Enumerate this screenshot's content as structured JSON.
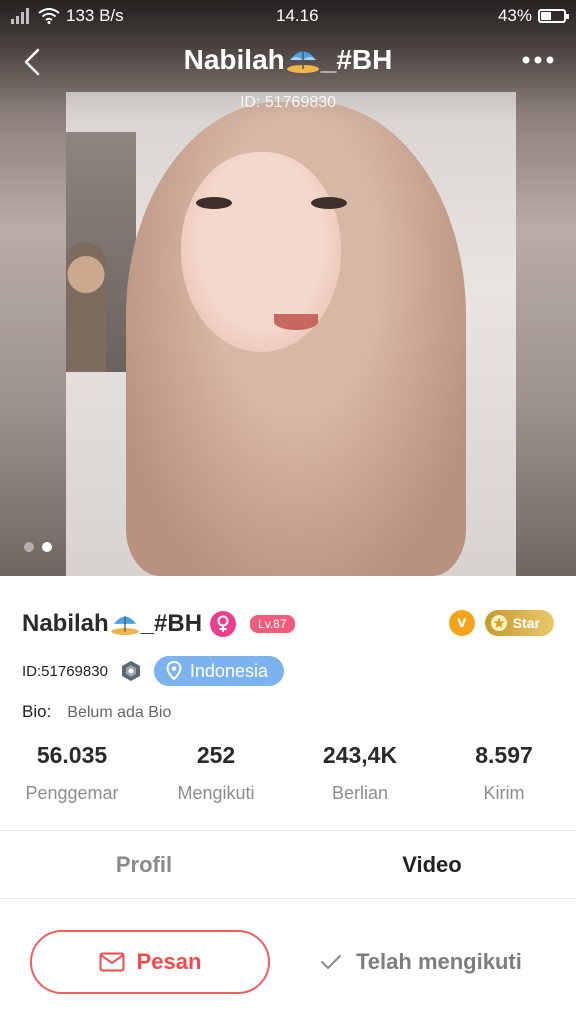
{
  "status_bar": {
    "speed": "133 B/s",
    "time": "14.16",
    "battery": "43%",
    "battery_level": 0.43
  },
  "header": {
    "title_prefix": "Nabilah",
    "title_suffix": "_#BH",
    "id_line": "ID: 51769830"
  },
  "carousel": {
    "page_count": 2,
    "active_index": 1
  },
  "profile": {
    "name_prefix": "Nabilah",
    "name_suffix": "_#BH",
    "level": "Lv.87",
    "v_badge": "v",
    "star_label": "Star",
    "id_text": "ID:51769830",
    "location": "Indonesia",
    "bio_label": "Bio:",
    "bio_text": "Belum ada Bio"
  },
  "stats": [
    {
      "value": "56.035",
      "label": "Penggemar"
    },
    {
      "value": "252",
      "label": "Mengikuti"
    },
    {
      "value": "243,4K",
      "label": "Berlian"
    },
    {
      "value": "8.597",
      "label": "Kirim"
    }
  ],
  "tabs": [
    {
      "label": "Profil",
      "active": false
    },
    {
      "label": "Video",
      "active": true
    }
  ],
  "actions": {
    "message_label": "Pesan",
    "follow_label": "Telah mengikuti"
  },
  "colors": {
    "accent_red": "#ee4b4b",
    "gender_pink": "#ea3f8f",
    "level_pink": "#f15c7b",
    "location_blue": "#7cb3ef",
    "gold": "#f2a51c"
  },
  "icons": [
    "signal-icon",
    "wifi-icon",
    "battery-icon",
    "back-icon",
    "more-icon",
    "umbrella-emoji-icon",
    "female-icon",
    "v-badge-icon",
    "star-icon",
    "shield-icon",
    "location-pin-icon",
    "mail-icon",
    "check-icon"
  ]
}
